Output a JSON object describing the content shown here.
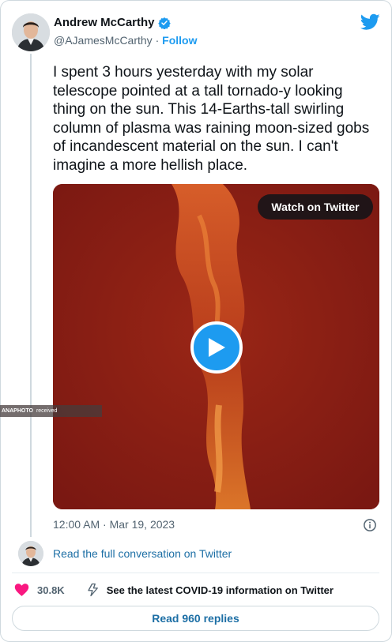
{
  "header": {
    "name": "Andrew McCarthy",
    "handle": "@AJamesMcCarthy",
    "separator": "·",
    "follow_label": "Follow"
  },
  "tweet": {
    "text": "I spent 3 hours yesterday with my solar telescope pointed at a tall tornado-y looking thing on the sun. This 14-Earths-tall swirling column of plasma was raining moon-sized gobs of incandescent material on the sun. I can't imagine a more hellish place.",
    "timestamp": "12:00 AM · Mar 19, 2023"
  },
  "media": {
    "watch_label": "Watch on Twitter",
    "watermark_brand": "ANAPHOTO",
    "watermark_text": "received"
  },
  "footer": {
    "read_conversation": "Read the full conversation on Twitter",
    "like_count": "30.8K",
    "covid_text": "See the latest COVID-19 information on Twitter",
    "replies_label": "Read 960 replies"
  },
  "colors": {
    "accent": "#1d9bf0",
    "link": "#1d6fa5",
    "heart": "#f91880",
    "media_bg": "#8a1c14"
  },
  "icons": {
    "verified": "verified-badge-icon",
    "logo": "twitter-bird-icon",
    "play": "play-icon",
    "info": "info-icon",
    "like": "heart-icon",
    "covid": "lightning-icon"
  }
}
